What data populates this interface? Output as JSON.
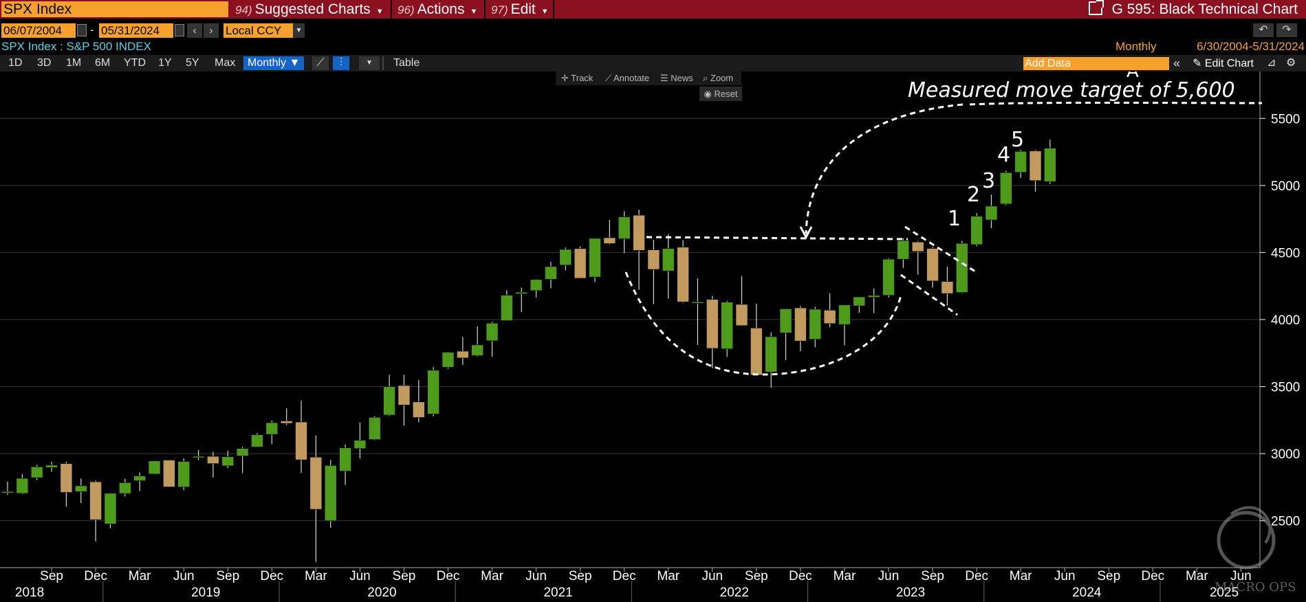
{
  "topbar": {
    "ticker": "SPX Index",
    "menus": [
      {
        "num": "94)",
        "label": "Suggested Charts"
      },
      {
        "num": "96)",
        "label": "Actions"
      },
      {
        "num": "97)",
        "label": "Edit"
      }
    ],
    "title": "G 595: Black Technical Chart"
  },
  "controls": {
    "start_date": "06/07/2004",
    "date_sep": "-",
    "end_date": "05/31/2024",
    "currency": "Local CCY"
  },
  "security": {
    "name": "SPX Index : S&P 500 INDEX",
    "frequency": "Monthly",
    "range": "6/30/2004-5/31/2024"
  },
  "toolbar": {
    "periods": [
      "1D",
      "3D",
      "1M",
      "6M",
      "YTD",
      "1Y",
      "5Y",
      "Max"
    ],
    "frequency_button": "Monthly ▼",
    "table_label": "Table",
    "add_data_placeholder": "Add Data",
    "edit_chart_label": "Edit Chart"
  },
  "chart_tools": {
    "track": "Track",
    "annotate": "Annotate",
    "news": "News",
    "zoom": "Zoom",
    "reset": "Reset"
  },
  "watermark": "MACRO OPS",
  "chart_data": {
    "type": "candlestick",
    "series_name": "SPX Index",
    "ylim": [
      2150,
      5850
    ],
    "y_ticks": [
      2500,
      3000,
      3500,
      4000,
      4500,
      5000,
      5500
    ],
    "x_tick_months": [
      "Sep",
      "Dec",
      "Mar",
      "Jun",
      "Sep",
      "Dec",
      "Mar",
      "Jun",
      "Sep",
      "Dec",
      "Mar",
      "Jun",
      "Sep",
      "Dec",
      "Mar",
      "Jun",
      "Sep",
      "Dec",
      "Mar",
      "Jun",
      "Sep",
      "Dec",
      "Mar",
      "Jun",
      "Sep",
      "Dec",
      "Mar",
      "Jun"
    ],
    "x_tick_years": [
      "2018",
      "2019",
      "2020",
      "2021",
      "2022",
      "2023",
      "2024",
      "2025"
    ],
    "up_color": "#4e9a1a",
    "down_color": "#c09a5e",
    "candles": [
      {
        "date": "2018-06",
        "o": 2718,
        "h": 2791,
        "l": 2692,
        "c": 2718
      },
      {
        "date": "2018-07",
        "o": 2704,
        "h": 2848,
        "l": 2698,
        "c": 2816
      },
      {
        "date": "2018-08",
        "o": 2821,
        "h": 2917,
        "l": 2802,
        "c": 2902
      },
      {
        "date": "2018-09",
        "o": 2896,
        "h": 2941,
        "l": 2864,
        "c": 2914
      },
      {
        "date": "2018-10",
        "o": 2926,
        "h": 2940,
        "l": 2604,
        "c": 2711
      },
      {
        "date": "2018-11",
        "o": 2717,
        "h": 2815,
        "l": 2632,
        "c": 2760
      },
      {
        "date": "2018-12",
        "o": 2790,
        "h": 2800,
        "l": 2346,
        "c": 2507
      },
      {
        "date": "2019-01",
        "o": 2476,
        "h": 2708,
        "l": 2444,
        "c": 2704
      },
      {
        "date": "2019-02",
        "o": 2703,
        "h": 2813,
        "l": 2681,
        "c": 2784
      },
      {
        "date": "2019-03",
        "o": 2798,
        "h": 2860,
        "l": 2722,
        "c": 2834
      },
      {
        "date": "2019-04",
        "o": 2848,
        "h": 2949,
        "l": 2848,
        "c": 2946
      },
      {
        "date": "2019-05",
        "o": 2952,
        "h": 2954,
        "l": 2750,
        "c": 2752
      },
      {
        "date": "2019-06",
        "o": 2751,
        "h": 2964,
        "l": 2728,
        "c": 2942
      },
      {
        "date": "2019-07",
        "o": 2971,
        "h": 3028,
        "l": 2952,
        "c": 2980
      },
      {
        "date": "2019-08",
        "o": 2980,
        "h": 3014,
        "l": 2822,
        "c": 2926
      },
      {
        "date": "2019-09",
        "o": 2909,
        "h": 3022,
        "l": 2892,
        "c": 2977
      },
      {
        "date": "2019-10",
        "o": 2983,
        "h": 3050,
        "l": 2855,
        "c": 3038
      },
      {
        "date": "2019-11",
        "o": 3050,
        "h": 3154,
        "l": 3050,
        "c": 3141
      },
      {
        "date": "2019-12",
        "o": 3144,
        "h": 3248,
        "l": 3070,
        "c": 3231
      },
      {
        "date": "2020-01",
        "o": 3244,
        "h": 3338,
        "l": 3214,
        "c": 3226
      },
      {
        "date": "2020-02",
        "o": 3236,
        "h": 3394,
        "l": 2855,
        "c": 2954
      },
      {
        "date": "2020-03",
        "o": 2974,
        "h": 3136,
        "l": 2192,
        "c": 2585
      },
      {
        "date": "2020-04",
        "o": 2499,
        "h": 2954,
        "l": 2447,
        "c": 2912
      },
      {
        "date": "2020-05",
        "o": 2870,
        "h": 3068,
        "l": 2766,
        "c": 3044
      },
      {
        "date": "2020-06",
        "o": 3038,
        "h": 3233,
        "l": 2965,
        "c": 3100
      },
      {
        "date": "2020-07",
        "o": 3105,
        "h": 3280,
        "l": 3101,
        "c": 3271
      },
      {
        "date": "2020-08",
        "o": 3288,
        "h": 3588,
        "l": 3280,
        "c": 3500
      },
      {
        "date": "2020-09",
        "o": 3508,
        "h": 3588,
        "l": 3209,
        "c": 3363
      },
      {
        "date": "2020-10",
        "o": 3386,
        "h": 3549,
        "l": 3234,
        "c": 3270
      },
      {
        "date": "2020-11",
        "o": 3296,
        "h": 3646,
        "l": 3279,
        "c": 3622
      },
      {
        "date": "2020-12",
        "o": 3645,
        "h": 3760,
        "l": 3633,
        "c": 3756
      },
      {
        "date": "2021-01",
        "o": 3764,
        "h": 3870,
        "l": 3662,
        "c": 3714
      },
      {
        "date": "2021-02",
        "o": 3731,
        "h": 3950,
        "l": 3725,
        "c": 3811
      },
      {
        "date": "2021-03",
        "o": 3842,
        "h": 3983,
        "l": 3723,
        "c": 3973
      },
      {
        "date": "2021-04",
        "o": 3992,
        "h": 4218,
        "l": 3992,
        "c": 4181
      },
      {
        "date": "2021-05",
        "o": 4192,
        "h": 4238,
        "l": 4056,
        "c": 4204
      },
      {
        "date": "2021-06",
        "o": 4216,
        "h": 4302,
        "l": 4165,
        "c": 4298
      },
      {
        "date": "2021-07",
        "o": 4300,
        "h": 4430,
        "l": 4233,
        "c": 4395
      },
      {
        "date": "2021-08",
        "o": 4406,
        "h": 4538,
        "l": 4367,
        "c": 4523
      },
      {
        "date": "2021-09",
        "o": 4529,
        "h": 4546,
        "l": 4306,
        "c": 4308
      },
      {
        "date": "2021-10",
        "o": 4317,
        "h": 4608,
        "l": 4279,
        "c": 4605
      },
      {
        "date": "2021-11",
        "o": 4610,
        "h": 4744,
        "l": 4560,
        "c": 4567
      },
      {
        "date": "2021-12",
        "o": 4602,
        "h": 4808,
        "l": 4495,
        "c": 4766
      },
      {
        "date": "2022-01",
        "o": 4778,
        "h": 4819,
        "l": 4222,
        "c": 4516
      },
      {
        "date": "2022-02",
        "o": 4520,
        "h": 4595,
        "l": 4115,
        "c": 4374
      },
      {
        "date": "2022-03",
        "o": 4363,
        "h": 4637,
        "l": 4157,
        "c": 4530
      },
      {
        "date": "2022-04",
        "o": 4540,
        "h": 4593,
        "l": 4124,
        "c": 4132
      },
      {
        "date": "2022-05",
        "o": 4130,
        "h": 4307,
        "l": 3811,
        "c": 4132
      },
      {
        "date": "2022-06",
        "o": 4150,
        "h": 4177,
        "l": 3637,
        "c": 3785
      },
      {
        "date": "2022-07",
        "o": 3781,
        "h": 4141,
        "l": 3721,
        "c": 4130
      },
      {
        "date": "2022-08",
        "o": 4113,
        "h": 4325,
        "l": 3955,
        "c": 3955
      },
      {
        "date": "2022-09",
        "o": 3937,
        "h": 4119,
        "l": 3585,
        "c": 3586
      },
      {
        "date": "2022-10",
        "o": 3609,
        "h": 3905,
        "l": 3492,
        "c": 3872
      },
      {
        "date": "2022-11",
        "o": 3901,
        "h": 4080,
        "l": 3698,
        "c": 4080
      },
      {
        "date": "2022-12",
        "o": 4087,
        "h": 4101,
        "l": 3764,
        "c": 3840
      },
      {
        "date": "2023-01",
        "o": 3853,
        "h": 4095,
        "l": 3794,
        "c": 4077
      },
      {
        "date": "2023-02",
        "o": 4070,
        "h": 4195,
        "l": 3943,
        "c": 3970
      },
      {
        "date": "2023-03",
        "o": 3963,
        "h": 4111,
        "l": 3809,
        "c": 4109
      },
      {
        "date": "2023-04",
        "o": 4102,
        "h": 4170,
        "l": 4049,
        "c": 4169
      },
      {
        "date": "2023-05",
        "o": 4166,
        "h": 4232,
        "l": 4048,
        "c": 4180
      },
      {
        "date": "2023-06",
        "o": 4181,
        "h": 4458,
        "l": 4165,
        "c": 4450
      },
      {
        "date": "2023-07",
        "o": 4450,
        "h": 4607,
        "l": 4385,
        "c": 4589
      },
      {
        "date": "2023-08",
        "o": 4578,
        "h": 4584,
        "l": 4335,
        "c": 4508
      },
      {
        "date": "2023-09",
        "o": 4530,
        "h": 4541,
        "l": 4238,
        "c": 4288
      },
      {
        "date": "2023-10",
        "o": 4284,
        "h": 4393,
        "l": 4104,
        "c": 4194
      },
      {
        "date": "2023-11",
        "o": 4202,
        "h": 4587,
        "l": 4197,
        "c": 4568
      },
      {
        "date": "2023-12",
        "o": 4559,
        "h": 4793,
        "l": 4547,
        "c": 4770
      },
      {
        "date": "2024-01",
        "o": 4743,
        "h": 4932,
        "l": 4682,
        "c": 4846
      },
      {
        "date": "2024-02",
        "o": 4862,
        "h": 5111,
        "l": 4853,
        "c": 5096
      },
      {
        "date": "2024-03",
        "o": 5098,
        "h": 5265,
        "l": 5056,
        "c": 5254
      },
      {
        "date": "2024-04",
        "o": 5257,
        "h": 5264,
        "l": 4954,
        "c": 5036
      },
      {
        "date": "2024-05",
        "o": 5029,
        "h": 5342,
        "l": 5011,
        "c": 5278
      }
    ],
    "annotations": {
      "target_text": "Measured move target of 5,600",
      "target_level": 5600,
      "neckline_level": 4620,
      "wave_labels": [
        "1",
        "2",
        "3",
        "4",
        "5"
      ],
      "wave_a_label": "A"
    }
  }
}
